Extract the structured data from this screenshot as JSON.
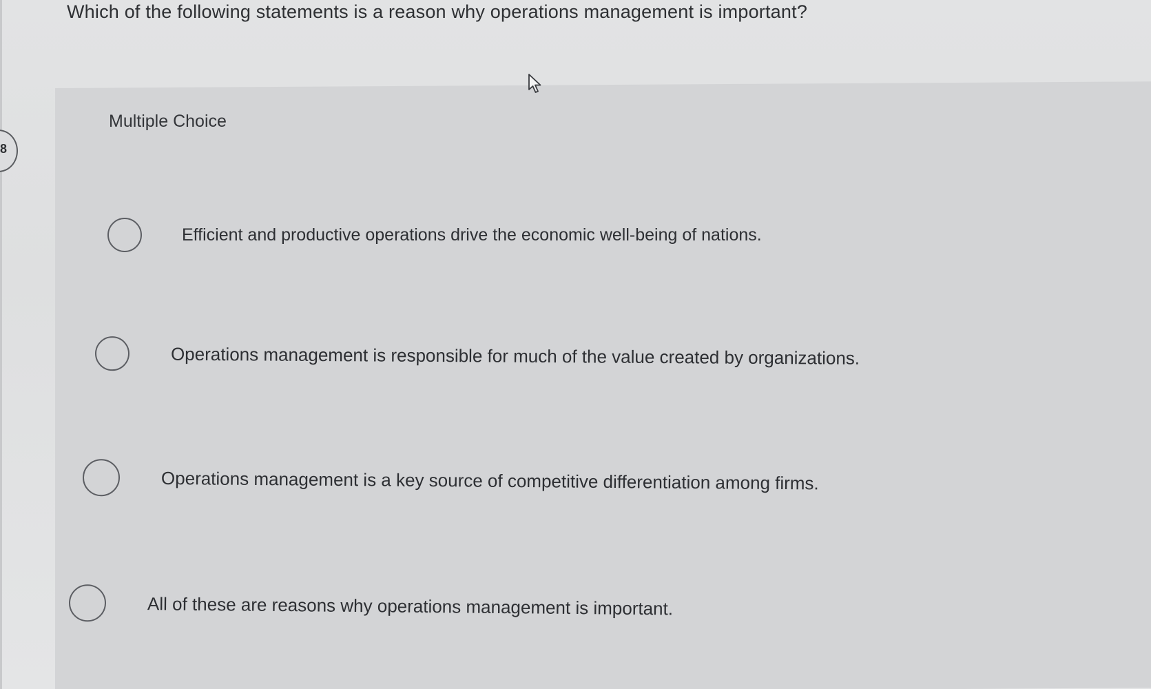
{
  "question": {
    "text": "Which of the following statements is a reason why operations management is important?"
  },
  "side_tab": {
    "label": "8"
  },
  "choice_section": {
    "type_label": "Multiple Choice",
    "options": [
      {
        "label": "Efficient and productive operations drive the economic well-being of nations.",
        "selected": false
      },
      {
        "label": "Operations management is responsible for much of the value created by organizations.",
        "selected": false
      },
      {
        "label": "Operations management is a key source of competitive differentiation among firms.",
        "selected": false
      },
      {
        "label": "All of these are reasons why operations management is important.",
        "selected": false
      }
    ]
  },
  "icons": {
    "cursor": "mouse-pointer-icon"
  }
}
